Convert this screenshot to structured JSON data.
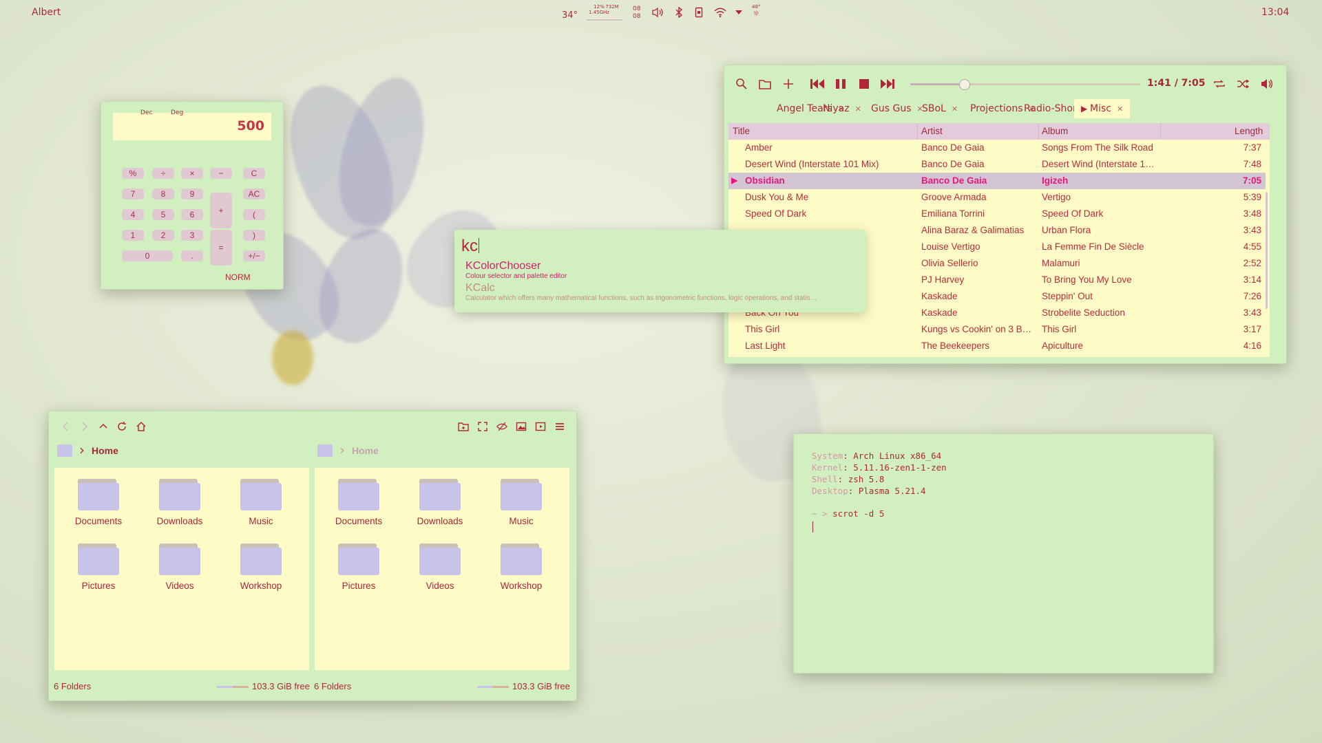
{
  "topbar": {
    "user": "Albert",
    "temp": "34°",
    "cpu": "12%",
    "cpu_freq": "1.45GHz",
    "mem": "732M",
    "date_day": "08",
    "date_month": "08",
    "weather": "48°",
    "clock": "13:04"
  },
  "calculator": {
    "mode_dec": "Dec",
    "mode_deg": "Deg",
    "display": "500",
    "keys": [
      "%",
      "÷",
      "×",
      "−",
      "C",
      "7",
      "8",
      "9",
      "+",
      "AC",
      "4",
      "5",
      "6",
      "(",
      "1",
      "2",
      "3",
      "=",
      ")",
      "0",
      ".",
      "+/−"
    ],
    "status": "NORM"
  },
  "player": {
    "position": "1:41 / 7:05",
    "progress": 0.235,
    "tabs": [
      "Angel Tears",
      "Niyaz",
      "Gus Gus",
      "SBoL",
      "Projections",
      "Radio-Short",
      "Misc"
    ],
    "columns": {
      "title": "Title",
      "artist": "Artist",
      "album": "Album",
      "length": "Length"
    },
    "rows": [
      {
        "title": "Amber",
        "artist": "Banco De Gaia",
        "album": "Songs From The Silk Road",
        "length": "7:37"
      },
      {
        "title": "Desert Wind (Interstate 101 Mix)",
        "artist": "Banco De Gaia",
        "album": "Desert Wind (Interstate 1…",
        "length": "7:48"
      },
      {
        "title": "Obsidian",
        "artist": "Banco De Gaia",
        "album": "Igizeh",
        "length": "7:05"
      },
      {
        "title": "Dusk You & Me",
        "artist": "Groove Armada",
        "album": "Vertigo",
        "length": "5:39"
      },
      {
        "title": "Speed Of Dark",
        "artist": "Emiliana Torrini",
        "album": "Speed Of Dark",
        "length": "3:48"
      },
      {
        "title": "",
        "artist": "Alina Baraz & Galimatias",
        "album": "Urban Flora",
        "length": "3:43"
      },
      {
        "title": "",
        "artist": "Louise Vertigo",
        "album": "La Femme Fin De Siècle",
        "length": "4:55"
      },
      {
        "title": "",
        "artist": "Olivia Sellerio",
        "album": "Malamuri",
        "length": "2:52"
      },
      {
        "title": "",
        "artist": "PJ Harvey",
        "album": "To Bring You My Love",
        "length": "3:14"
      },
      {
        "title": "",
        "artist": "Kaskade",
        "album": "Steppin' Out",
        "length": "7:26"
      },
      {
        "title": "Back On You",
        "artist": "Kaskade",
        "album": "Strobelite Seduction",
        "length": "3:43"
      },
      {
        "title": "This Girl",
        "artist": "Kungs vs Cookin' on 3 B…",
        "album": "This Girl",
        "length": "3:17"
      },
      {
        "title": "Last Light",
        "artist": "The Beekeepers",
        "album": "Apiculture",
        "length": "4:16"
      }
    ]
  },
  "launcher": {
    "query": "kc",
    "results": [
      {
        "name": "KColorChooser",
        "desc": "Colour selector and palette editor"
      },
      {
        "name": "KCalc",
        "desc": "Calculator which offers many mathematical functions, such as trigonometric functions, logic operations, and statis…"
      }
    ]
  },
  "filemanager": {
    "panes": [
      {
        "crumb": "Home",
        "folders": [
          "Documents",
          "Downloads",
          "Music",
          "Pictures",
          "Videos",
          "Workshop"
        ],
        "count": "6 Folders",
        "free": "103.3 GiB free"
      },
      {
        "crumb": "Home",
        "folders": [
          "Documents",
          "Downloads",
          "Music",
          "Pictures",
          "Videos",
          "Workshop"
        ],
        "count": "6 Folders",
        "free": "103.3 GiB free"
      }
    ]
  },
  "terminal": {
    "info": [
      {
        "key": "System",
        "value": "Arch Linux x86_64"
      },
      {
        "key": "Kernel",
        "value": "5.11.16-zen1-1-zen"
      },
      {
        "key": "Shell",
        "value": "zsh 5.8"
      },
      {
        "key": "Desktop",
        "value": "Plasma 5.21.4"
      }
    ],
    "prompt": "~ >",
    "command": "scrot -d 5"
  },
  "colors": {
    "accent": "#b3263a",
    "window": "#d2efc0",
    "content": "#fffbc6",
    "highlight": "#e8187f",
    "selection": "#d3c5d3"
  }
}
